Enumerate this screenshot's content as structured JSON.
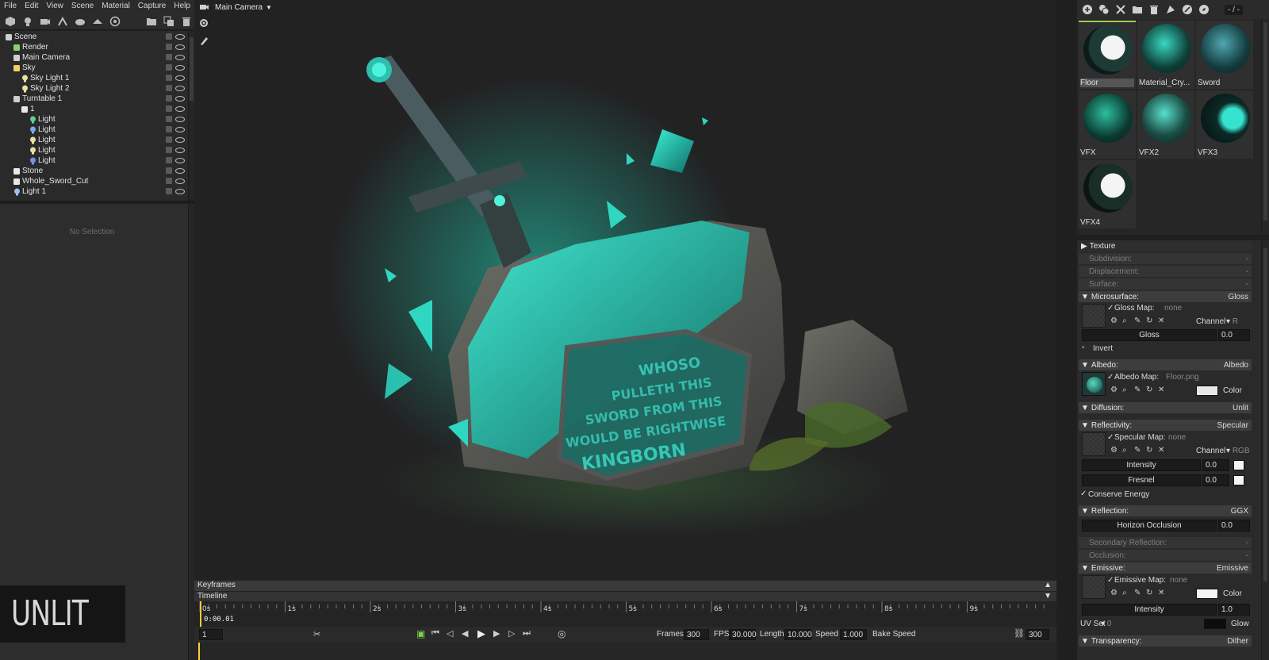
{
  "menu": [
    "File",
    "Edit",
    "View",
    "Scene",
    "Material",
    "Capture",
    "Help"
  ],
  "viewport": {
    "camera_label": "Main Camera",
    "render_mode": "UNLIT"
  },
  "scene_tree": [
    {
      "label": "Scene",
      "depth": 0,
      "icon": "scene-icon"
    },
    {
      "label": "Render",
      "depth": 1,
      "icon": "render-icon"
    },
    {
      "label": "Main Camera",
      "depth": 1,
      "icon": "camera-icon"
    },
    {
      "label": "Sky",
      "depth": 1,
      "icon": "sky-icon"
    },
    {
      "label": "Sky Light 1",
      "depth": 2,
      "icon": "bulb-icon"
    },
    {
      "label": "Sky Light 2",
      "depth": 2,
      "icon": "bulb-icon"
    },
    {
      "label": "Turntable 1",
      "depth": 1,
      "icon": "turntable-icon"
    },
    {
      "label": "1",
      "depth": 2,
      "icon": "mesh-icon"
    },
    {
      "label": "Light",
      "depth": 3,
      "icon": "bulb-icon",
      "color": "#5fd08a"
    },
    {
      "label": "Light",
      "depth": 3,
      "icon": "bulb-icon",
      "color": "#7aa9f0"
    },
    {
      "label": "Light",
      "depth": 3,
      "icon": "bulb-icon",
      "color": "#e8e0a8"
    },
    {
      "label": "Light",
      "depth": 3,
      "icon": "bulb-icon",
      "color": "#e8e0a8"
    },
    {
      "label": "Light",
      "depth": 3,
      "icon": "bulb-icon",
      "color": "#7a8fe8"
    },
    {
      "label": "Stone",
      "depth": 1,
      "icon": "mesh-icon"
    },
    {
      "label": "Whole_Sword_Cut",
      "depth": 1,
      "icon": "mesh-icon"
    },
    {
      "label": "Light 1",
      "depth": 1,
      "icon": "bulb-icon",
      "color": "#9fc0f0"
    }
  ],
  "inspector": {
    "empty_label": "No Selection"
  },
  "timeline": {
    "keyframes_label": "Keyframes",
    "timeline_label": "Timeline",
    "time_readout": "0:00.01",
    "ruler_ticks": [
      "0s",
      "1s",
      "2s",
      "3s",
      "4s",
      "5s",
      "6s",
      "7s",
      "8s",
      "9s"
    ],
    "frame_field": "1",
    "frames_label": "Frames",
    "frames_value": "300",
    "fps_label": "FPS",
    "fps_value": "30.000",
    "length_label": "Length",
    "length_value": "10.000",
    "speed_label": "Speed",
    "speed_value": "1.000",
    "bake_label": "Bake Speed",
    "end_frame": "300"
  },
  "right_toolbar": {
    "counter": "- / -"
  },
  "materials": [
    {
      "name": "Floor",
      "selected": true
    },
    {
      "name": "Material_Cry...",
      "selected": false
    },
    {
      "name": "Sword",
      "selected": false
    },
    {
      "name": "VFX",
      "selected": false
    },
    {
      "name": "VFX2",
      "selected": false
    },
    {
      "name": "VFX3",
      "selected": false
    },
    {
      "name": "VFX4",
      "selected": false
    }
  ],
  "properties": {
    "texture": "Texture",
    "subdivision": {
      "label": "Subdivision:",
      "value": "-"
    },
    "displacement": {
      "label": "Displacement:",
      "value": "-"
    },
    "surface": {
      "label": "Surface:",
      "value": "-"
    },
    "microsurface": {
      "label": "Microsurface:",
      "value": "Gloss"
    },
    "gloss_map": {
      "label": "Gloss Map:",
      "value": "none",
      "channel_label": "Channel",
      "channel": "R"
    },
    "gloss": {
      "label": "Gloss",
      "value": "0.0"
    },
    "invert": "Invert",
    "albedo": {
      "label": "Albedo:",
      "value": "Albedo"
    },
    "albedo_map": {
      "label": "Albedo Map:",
      "value": "Floor.png",
      "color_label": "Color"
    },
    "diffusion": {
      "label": "Diffusion:",
      "value": "Unlit"
    },
    "reflectivity": {
      "label": "Reflectivity:",
      "value": "Specular"
    },
    "specular_map": {
      "label": "Specular Map:",
      "value": "none",
      "channel_label": "Channel",
      "channel": "RGB"
    },
    "intensity": {
      "label": "Intensity",
      "value": "0.0"
    },
    "fresnel": {
      "label": "Fresnel",
      "value": "0.0"
    },
    "conserve": "Conserve Energy",
    "reflection": {
      "label": "Reflection:",
      "value": "GGX"
    },
    "horizon": {
      "label": "Horizon Occlusion",
      "value": "0.0"
    },
    "secondary": {
      "label": "Secondary Reflection:",
      "value": "-"
    },
    "occlusion": {
      "label": "Occlusion:",
      "value": "-"
    },
    "emissive": {
      "label": "Emissive:",
      "value": "Emissive"
    },
    "emissive_map": {
      "label": "Emissive Map:",
      "value": "none",
      "color_label": "Color"
    },
    "em_intensity": {
      "label": "Intensity",
      "value": "1.0"
    },
    "uv_set": {
      "label": "UV Set",
      "value": "0"
    },
    "glow": "Glow",
    "transparency": {
      "label": "Transparency:",
      "value": "Dither"
    }
  },
  "colors": {
    "accent": "#9ccd55",
    "teal": "#2fd6c0",
    "panel": "#2a2a2a"
  }
}
